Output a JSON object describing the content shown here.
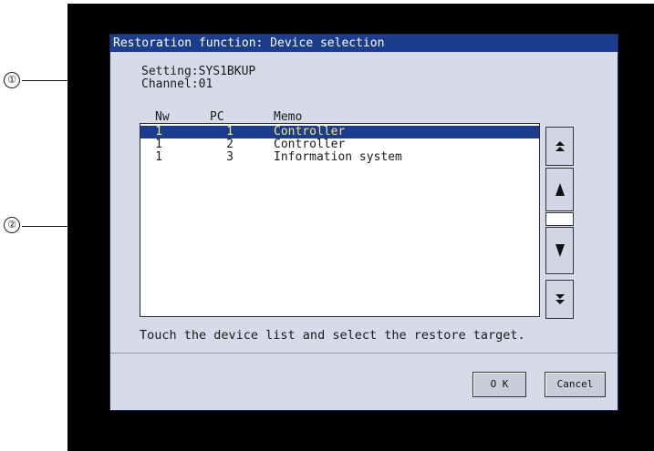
{
  "window": {
    "title": "Restoration function: Device selection"
  },
  "info": {
    "setting": "Setting:SYS1BKUP",
    "channel": "Channel:01"
  },
  "table": {
    "headers": [
      "Nw",
      "PC",
      "Memo"
    ],
    "rows": [
      {
        "nw": "1",
        "pc": "1",
        "memo": "Controller",
        "selected": true
      },
      {
        "nw": "1",
        "pc": "2",
        "memo": "Controller",
        "selected": false
      },
      {
        "nw": "1",
        "pc": "3",
        "memo": "Information system",
        "selected": false
      }
    ]
  },
  "scroll_buttons": [
    {
      "name": "scroll-top-button",
      "icon": "double-up-arrow-icon",
      "glyph": "⇞"
    },
    {
      "name": "scroll-up-button",
      "icon": "up-arrow-icon",
      "glyph": "▲"
    },
    {
      "name": "scroll-down-button",
      "icon": "down-arrow-icon",
      "glyph": "▼"
    },
    {
      "name": "scroll-bottom-button",
      "icon": "double-down-arrow-icon",
      "glyph": "⇟"
    }
  ],
  "instruction": "Touch the device list and select the restore target.",
  "buttons": {
    "ok": "O K",
    "cancel": "Cancel"
  },
  "callouts": {
    "one": "①",
    "two": "②"
  },
  "colors": {
    "title_bar": "#1c3d8e",
    "screen_bg": "#d7dbe9",
    "selected_text": "#f2ea6b"
  }
}
